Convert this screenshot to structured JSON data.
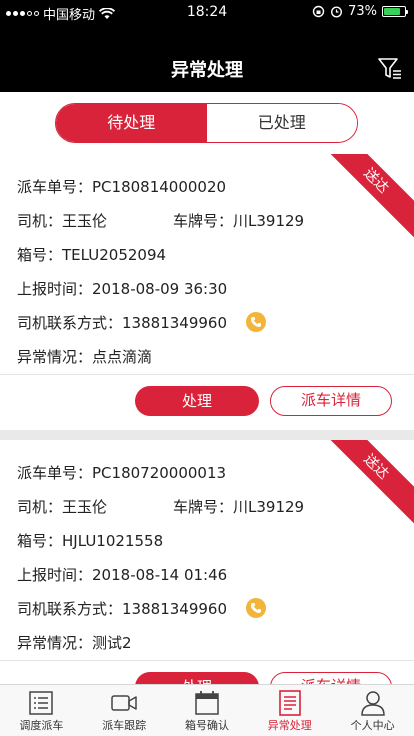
{
  "status_bar": {
    "carrier": "中国移动",
    "time": "18:24",
    "battery": "73%"
  },
  "header": {
    "title": "异常处理"
  },
  "segments": {
    "pending": "待处理",
    "done": "已处理"
  },
  "cards": [
    {
      "ribbon": "送达",
      "dispatch_label": "派车单号：",
      "dispatch_no": "PC180814000020",
      "driver_label": "司机：",
      "driver": "王玉伦",
      "plate_label": "车牌号：",
      "plate": "川L39129",
      "box_label": "箱号：",
      "box_no": "TELU2052094",
      "report_label": "上报时间：",
      "report_time": "2018-08-09 36:30",
      "phone_label": "司机联系方式：",
      "phone": "13881349960",
      "anomaly_label": "异常情况：",
      "anomaly": "点点滴滴",
      "handle_label": "处理",
      "detail_label": "派车详情"
    },
    {
      "ribbon": "送达",
      "dispatch_label": "派车单号：",
      "dispatch_no": "PC180720000013",
      "driver_label": "司机：",
      "driver": "王玉伦",
      "plate_label": "车牌号：",
      "plate": "川L39129",
      "box_label": "箱号：",
      "box_no": "HJLU1021558",
      "report_label": "上报时间：",
      "report_time": "2018-08-14 01:46",
      "phone_label": "司机联系方式：",
      "phone": "13881349960",
      "anomaly_label": "异常情况：",
      "anomaly": "测试2",
      "handle_label": "处理",
      "detail_label": "派车详情"
    }
  ],
  "tabbar": [
    {
      "label": "调度派车",
      "icon": "list-icon"
    },
    {
      "label": "派车跟踪",
      "icon": "video-icon"
    },
    {
      "label": "箱号确认",
      "icon": "calendar-icon"
    },
    {
      "label": "异常处理",
      "icon": "document-icon",
      "active": true
    },
    {
      "label": "个人中心",
      "icon": "person-icon"
    }
  ],
  "colors": {
    "accent": "#d9233a",
    "phone_icon": "#f2b43a",
    "header_bg": "#000000"
  }
}
